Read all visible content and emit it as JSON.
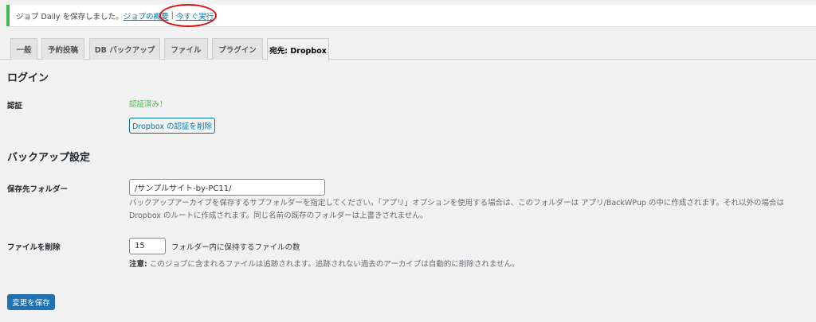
{
  "notice": {
    "message": "ジョブ Daily を保存しました。",
    "link_overview": "ジョブの概要",
    "separator": "|",
    "link_run_now": "今すぐ実行",
    "border_color": "#46b450",
    "highlight_color": "#e01010"
  },
  "tabs": [
    {
      "label": "一般",
      "active": false
    },
    {
      "label": "予約投稿",
      "active": false
    },
    {
      "label": "DB バックアップ",
      "active": false
    },
    {
      "label": "ファイル",
      "active": false
    },
    {
      "label": "プラグイン",
      "active": false
    },
    {
      "label": "宛先: Dropbox",
      "active": true
    }
  ],
  "login_section": {
    "heading": "ログイン",
    "auth_label": "認証",
    "auth_status": "認証済み！",
    "delete_auth_button": "Dropbox の認証を削除"
  },
  "backup_section": {
    "heading": "バックアップ設定",
    "folder_label": "保存先フォルダー",
    "folder_value": "/サンプルサイト-by-PC11/",
    "folder_desc_line1": "バックアップアーカイブを保存するサブフォルダーを指定してください。「アプリ」オプションを使用する場合は、このフォルダーは アプリ/BackWPup の中に作成されます。それ以外の場合は",
    "folder_desc_line2": "Dropbox のルートに作成されます。同じ名前の既存のフォルダーは上書きされません。",
    "delete_files_label": "ファイルを削除",
    "delete_files_value": "15",
    "delete_files_suffix": "フォルダー内に保持するファイルの数",
    "note_label": "注意:",
    "note_text": " このジョブに含まれるファイルは追跡されます。追跡されない過去のアーカイブは自動的に削除されません。"
  },
  "save_button": "変更を保存",
  "colors": {
    "accent": "#0073aa",
    "primary_button": "#2271b1",
    "success": "#46b450"
  }
}
